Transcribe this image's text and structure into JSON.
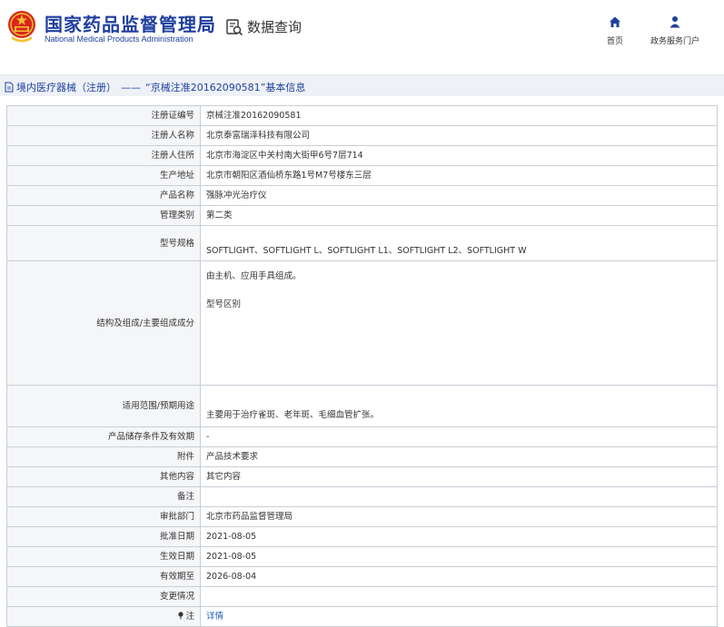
{
  "header": {
    "brand_cn": "国家药品监督管理局",
    "brand_en": "National Medical Products Administration",
    "data_query": "数据查询",
    "nav": [
      {
        "label": "首页",
        "icon": "home-icon"
      },
      {
        "label": "政务服务门户",
        "icon": "user-icon"
      }
    ]
  },
  "breadcrumb": {
    "category": "境内医疗器械（注册）",
    "separator": "——",
    "title": "“京械注准20162090581”基本信息"
  },
  "rows": [
    {
      "label": "注册证编号",
      "value": "京械注准20162090581"
    },
    {
      "label": "注册人名称",
      "value": "北京泰富瑞泽科技有限公司"
    },
    {
      "label": "注册人住所",
      "value": "北京市海淀区中关村南大街甲6号7层714"
    },
    {
      "label": "生产地址",
      "value": "北京市朝阳区酒仙桥东路1号M7号楼东三层"
    },
    {
      "label": "产品名称",
      "value": "强脉冲光治疗仪"
    },
    {
      "label": "管理类别",
      "value": "第二类"
    },
    {
      "label": "型号规格",
      "value": "SOFTLIGHT、SOFTLIGHT L、SOFTLIGHT L1、SOFTLIGHT L2、SOFTLIGHT W"
    },
    {
      "label": "结构及组成/主要组成成分",
      "value": "由主机、应用手具组成。",
      "value2": "型号区别"
    },
    {
      "label": "适用范围/预期用途",
      "value": "主要用于治疗雀斑、老年斑、毛细血管扩张。"
    },
    {
      "label": "产品储存条件及有效期",
      "value": "-"
    },
    {
      "label": "附件",
      "value": "产品技术要求"
    },
    {
      "label": "其他内容",
      "value": "其它内容"
    },
    {
      "label": "备注",
      "value": ""
    },
    {
      "label": "审批部门",
      "value": "北京市药品监督管理局"
    },
    {
      "label": "批准日期",
      "value": "2021-08-05"
    },
    {
      "label": "生效日期",
      "value": "2021-08-05"
    },
    {
      "label": "有效期至",
      "value": "2026-08-04"
    },
    {
      "label": "变更情况",
      "value": ""
    },
    {
      "label": "注",
      "value": "详情"
    }
  ],
  "colors": {
    "brand_blue": "#1f3f9e",
    "link_blue": "#1f5fbf",
    "bar_bg": "#eef1f6",
    "label_bg": "#f5f6f8"
  }
}
